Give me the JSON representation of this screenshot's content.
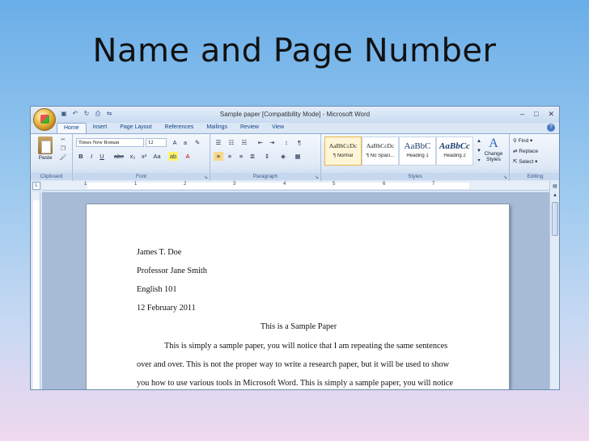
{
  "slide": {
    "title": "Name and Page Number"
  },
  "window": {
    "title": "Sample paper [Compatibility Mode] - Microsoft Word",
    "controls": {
      "minimize": "–",
      "maximize": "□",
      "close": "✕"
    }
  },
  "quick_access": {
    "customize": "⇋"
  },
  "tabs": [
    "Home",
    "Insert",
    "Page Layout",
    "References",
    "Mailings",
    "Review",
    "View"
  ],
  "ribbon": {
    "clipboard": {
      "label": "Clipboard",
      "paste": "Paste"
    },
    "font": {
      "label": "Font",
      "name": "Times New Roman",
      "size": "12"
    },
    "paragraph": {
      "label": "Paragraph",
      "pilcrow": "¶"
    },
    "styles": {
      "label": "Styles",
      "tiles": [
        {
          "sample": "AaBbCcDc",
          "name": "¶ Normal"
        },
        {
          "sample": "AaBbCcDc",
          "name": "¶ No Spaci..."
        },
        {
          "sample": "AaBbC",
          "name": "Heading 1"
        },
        {
          "sample": "AaBbCc",
          "name": "Heading 2"
        }
      ],
      "change_styles": "Change Styles"
    },
    "editing": {
      "label": "Editing",
      "find": "Find",
      "replace": "Replace",
      "select": "Select"
    }
  },
  "ruler": {
    "numbers": [
      "1",
      "1",
      "2",
      "3",
      "4",
      "5",
      "6",
      "7"
    ]
  },
  "document": {
    "lines": [
      "James T. Doe",
      "Professor Jane Smith",
      "English 101",
      "12 February 2011"
    ],
    "heading": "This is a Sample Paper",
    "body": [
      "This is simply a sample paper, you will notice that I am repeating the same sentences",
      "over and over.  This is not the proper way to write a research paper, but it will be used to show",
      "you how to use various tools in Microsoft Word. This is simply a sample paper, you will notice"
    ]
  }
}
